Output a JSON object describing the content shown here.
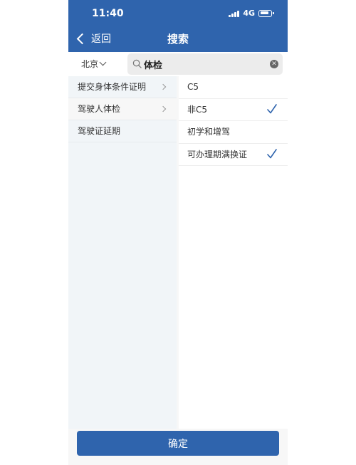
{
  "status_bar": {
    "time": "11:40",
    "network": "4G"
  },
  "nav": {
    "back_label": "返回",
    "title": "搜索"
  },
  "search": {
    "city": "北京",
    "query": "体检"
  },
  "categories": [
    {
      "label": "提交身体条件证明",
      "has_arrow": true
    },
    {
      "label": "驾驶人体检",
      "has_arrow": true,
      "selected": true
    },
    {
      "label": "驾驶证延期",
      "has_arrow": false
    }
  ],
  "options": [
    {
      "label": "C5",
      "checked": false
    },
    {
      "label": "非C5",
      "checked": true
    },
    {
      "label": "初学和增驾",
      "checked": false
    },
    {
      "label": "可办理期满换证",
      "checked": true
    }
  ],
  "confirm_label": "确定",
  "colors": {
    "primary": "#2f64ad",
    "check": "#2f64ad"
  }
}
